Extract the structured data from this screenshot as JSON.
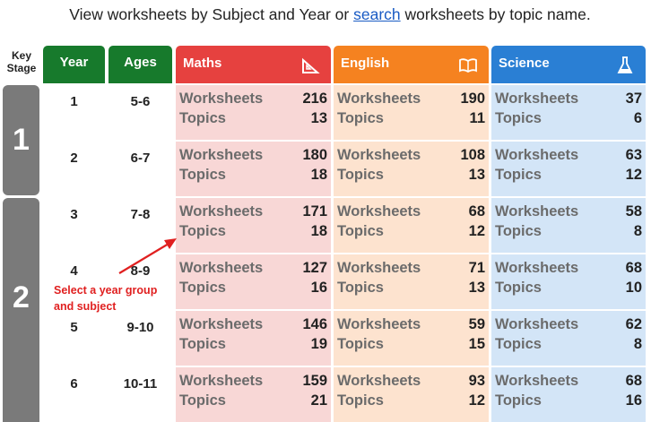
{
  "intro": {
    "before": "View worksheets by Subject and Year or ",
    "link": "search",
    "after": " worksheets by topic name."
  },
  "headers": {
    "key_stage": "Key Stage",
    "year": "Year",
    "ages": "Ages",
    "maths": "Maths",
    "english": "English",
    "science": "Science"
  },
  "key_stages": [
    "1",
    "2"
  ],
  "labels": {
    "worksheets": "Worksheets",
    "topics": "Topics"
  },
  "rows": [
    {
      "year": "1",
      "ages": "5-6",
      "maths": {
        "worksheets": "216",
        "topics": "13"
      },
      "english": {
        "worksheets": "190",
        "topics": "11"
      },
      "science": {
        "worksheets": "37",
        "topics": "6"
      }
    },
    {
      "year": "2",
      "ages": "6-7",
      "maths": {
        "worksheets": "180",
        "topics": "18"
      },
      "english": {
        "worksheets": "108",
        "topics": "13"
      },
      "science": {
        "worksheets": "63",
        "topics": "12"
      }
    },
    {
      "year": "3",
      "ages": "7-8",
      "maths": {
        "worksheets": "171",
        "topics": "18"
      },
      "english": {
        "worksheets": "68",
        "topics": "12"
      },
      "science": {
        "worksheets": "58",
        "topics": "8"
      }
    },
    {
      "year": "4",
      "ages": "8-9",
      "maths": {
        "worksheets": "127",
        "topics": "16"
      },
      "english": {
        "worksheets": "71",
        "topics": "13"
      },
      "science": {
        "worksheets": "68",
        "topics": "10"
      }
    },
    {
      "year": "5",
      "ages": "9-10",
      "maths": {
        "worksheets": "146",
        "topics": "19"
      },
      "english": {
        "worksheets": "59",
        "topics": "15"
      },
      "science": {
        "worksheets": "62",
        "topics": "8"
      }
    },
    {
      "year": "6",
      "ages": "10-11",
      "maths": {
        "worksheets": "159",
        "topics": "21"
      },
      "english": {
        "worksheets": "93",
        "topics": "12"
      },
      "science": {
        "worksheets": "68",
        "topics": "16"
      }
    }
  ],
  "annotation": {
    "line1": "Select a year group",
    "line2": "and subject"
  },
  "icons": {
    "maths": "set-square-icon",
    "english": "open-book-icon",
    "science": "flask-icon"
  },
  "colors": {
    "maths": "#e6413f",
    "english": "#f58220",
    "science": "#2a7fd4",
    "year": "#177a2c",
    "key_stage": "#7a7a7a",
    "annotation": "#e02020"
  }
}
